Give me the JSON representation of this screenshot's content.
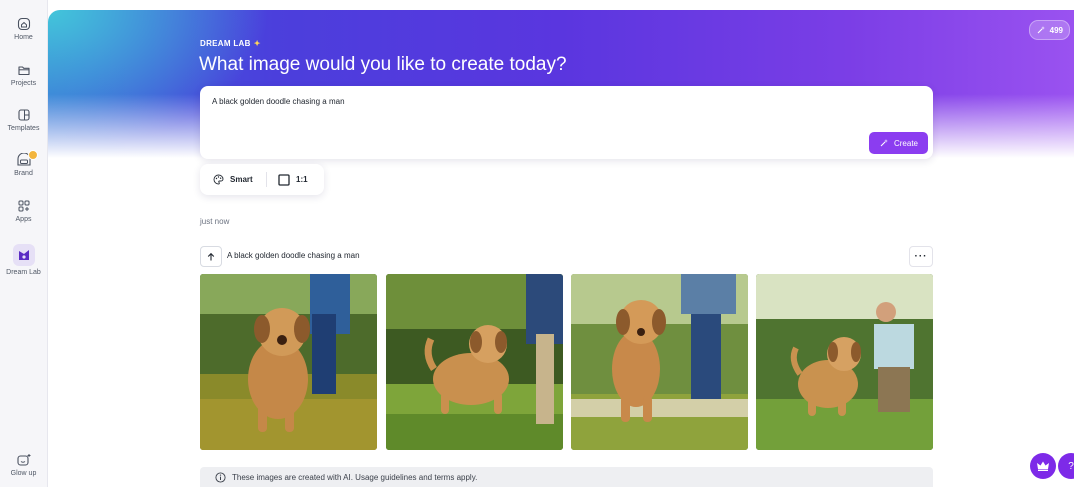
{
  "sidebar": {
    "items": [
      {
        "label": "Home",
        "icon": "home-icon"
      },
      {
        "label": "Projects",
        "icon": "folder-icon"
      },
      {
        "label": "Templates",
        "icon": "templates-icon"
      },
      {
        "label": "Brand",
        "icon": "brand-icon"
      },
      {
        "label": "Apps",
        "icon": "apps-icon"
      },
      {
        "label": "Dream Lab",
        "icon": "dream-lab-icon"
      }
    ],
    "glow_up_label": "Glow up"
  },
  "hero": {
    "tag": "DREAM LAB",
    "title": "What image would you like to create today?",
    "credits": "499"
  },
  "prompt": {
    "text": "A black golden doodle chasing a man",
    "create_label": "Create"
  },
  "options": {
    "style_label": "Smart",
    "ratio_label": "1:1"
  },
  "results": {
    "timestamp": "just now",
    "prompt": "A black golden doodle chasing a man",
    "images": [
      "generated-image-1",
      "generated-image-2",
      "generated-image-3",
      "generated-image-4"
    ]
  },
  "notice": {
    "text": "These images are created with AI. Usage guidelines and terms apply."
  },
  "colors": {
    "accent": "#8b3df0",
    "hero_start": "#3b66d8",
    "hero_end": "#9a52f0",
    "fab": "#7d2ae8"
  }
}
